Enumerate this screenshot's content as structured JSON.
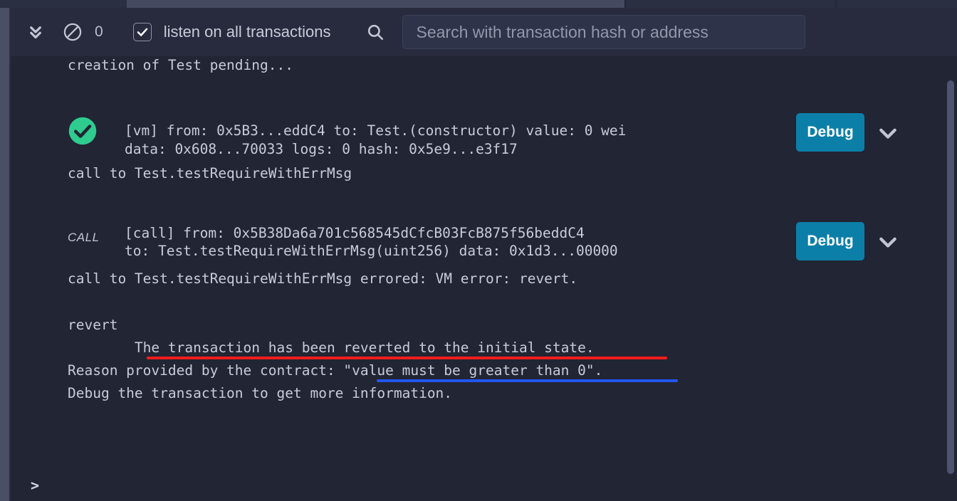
{
  "toolbar": {
    "collapse_all_icon": "double-chevron-down-icon",
    "clear_icon": "ban-icon",
    "clear_count": "0",
    "listen_checkbox_checked": true,
    "listen_label": "listen on all transactions",
    "search_icon": "search-icon",
    "search_placeholder": "Search with transaction hash or address",
    "search_value": ""
  },
  "terminal": {
    "pending_line": "creation of Test pending...",
    "prompt_symbol": ">",
    "entries": [
      {
        "status_icon": "success-check-circle-icon",
        "status_label": "",
        "line1": "[vm] from: 0x5B3...eddC4 to: Test.(constructor) value: 0 wei",
        "line2": "data: 0x608...70033 logs: 0 hash: 0x5e9...e3f17",
        "call_line": "call to Test.testRequireWithErrMsg",
        "debug_label": "Debug",
        "expand_icon": "chevron-down-icon"
      },
      {
        "status_icon": "call-text-badge",
        "status_label": "CALL",
        "line1": "[call] from: 0x5B38Da6a701c568545dCfcB03FcB875f56beddC4",
        "line2": "to: Test.testRequireWithErrMsg(uint256) data: 0x1d3...00000",
        "call_line": "call to Test.testRequireWithErrMsg errored: VM error: revert.",
        "debug_label": "Debug",
        "expand_icon": "chevron-down-icon"
      }
    ],
    "revert_block": {
      "heading": "revert",
      "line1": "        The transaction has been reverted to the initial state.",
      "line2": "Reason provided by the contract: \"value must be greater than 0\".",
      "line3": "Debug the transaction to get more information."
    }
  },
  "annotations": [
    {
      "name": "red-underline",
      "target": "The transaction has been reverted to the initial state.",
      "color": "#f41c1c"
    },
    {
      "name": "blue-underline",
      "target": "\"value must be greater than 0\".",
      "color": "#2256f0"
    }
  ],
  "colors": {
    "background": "#222533",
    "toolbar_background": "#272b3d",
    "debug_button": "#0c7fa8",
    "success_green": "#2ecc8f",
    "text": "#c8ccda",
    "scrollbar_thumb": "#4e5470"
  }
}
